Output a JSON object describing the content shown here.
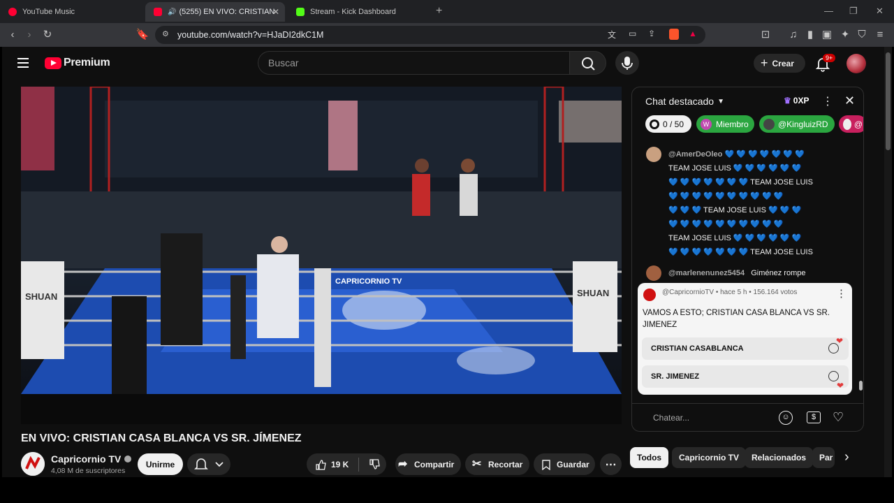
{
  "browser": {
    "tabs": [
      {
        "title": "YouTube Music",
        "favicon_color": "#ff0033"
      },
      {
        "title": "(5255) EN VIVO: CRISTIAN CA",
        "favicon_color": "#ff0033"
      },
      {
        "title": "Stream - Kick Dashboard",
        "favicon_color": "#53fc18"
      }
    ],
    "new_tab": "+",
    "url": "youtube.com/watch?v=HJaDI2dkC1M"
  },
  "youtube": {
    "logo_text": "Premium",
    "search_placeholder": "Buscar",
    "create_label": "Crear",
    "notif_badge": "9+"
  },
  "video": {
    "title": "EN VIVO: CRISTIAN CASA BLANCA VS SR. JÍMENEZ",
    "channel_name": "Capricornio TV",
    "subscribers": "4,08 M de suscriptores",
    "join_label": "Unirme",
    "like_count": "19 K",
    "share_label": "Compartir",
    "clip_label": "Recortar",
    "save_label": "Guardar",
    "ring_banner": "CAPRICORNIO TV",
    "ring_side": "SHUAN"
  },
  "chat": {
    "header": "Chat destacado",
    "xp": "0XP",
    "chips": [
      {
        "label": "0 / 50"
      },
      {
        "label": "Miembro"
      },
      {
        "label": "@KingluizRD"
      },
      {
        "label": "@"
      }
    ],
    "messages": [
      {
        "author": "@AmerDeOleo",
        "lines": [
          "💙 💙 💙 💙 💙 💙 💙",
          "TEAM JOSE LUIS 💙 💙 💙 💙 💙 💙",
          "💙 💙 💙 💙 💙 💙 💙 TEAM JOSE LUIS",
          "💙 💙 💙 💙 💙 💙 💙 💙 💙 💙",
          "💙 💙 💙 TEAM JOSE LUIS 💙 💙 💙",
          "💙 💙 💙 💙 💙 💙 💙 💙 💙 💙",
          "TEAM JOSE LUIS 💙 💙 💙 💙 💙 💙",
          "💙 💙 💙 💙 💙 💙 💙 TEAM JOSE LUIS"
        ]
      },
      {
        "author": "@marlenenunez5454",
        "text": "Giménez rompe"
      }
    ],
    "poll": {
      "meta": "@CapricornioTV • hace 5 h • 156.164 votos",
      "question": "VAMOS A ESTO; CRISTIAN CASA BLANCA VS SR. JIMENEZ",
      "options": [
        "CRISTIAN CASABLANCA",
        "SR. JIMENEZ"
      ]
    },
    "input_placeholder": "Chatear..."
  },
  "filters": [
    "Todos",
    "Capricornio TV",
    "Relacionados",
    "Par"
  ]
}
